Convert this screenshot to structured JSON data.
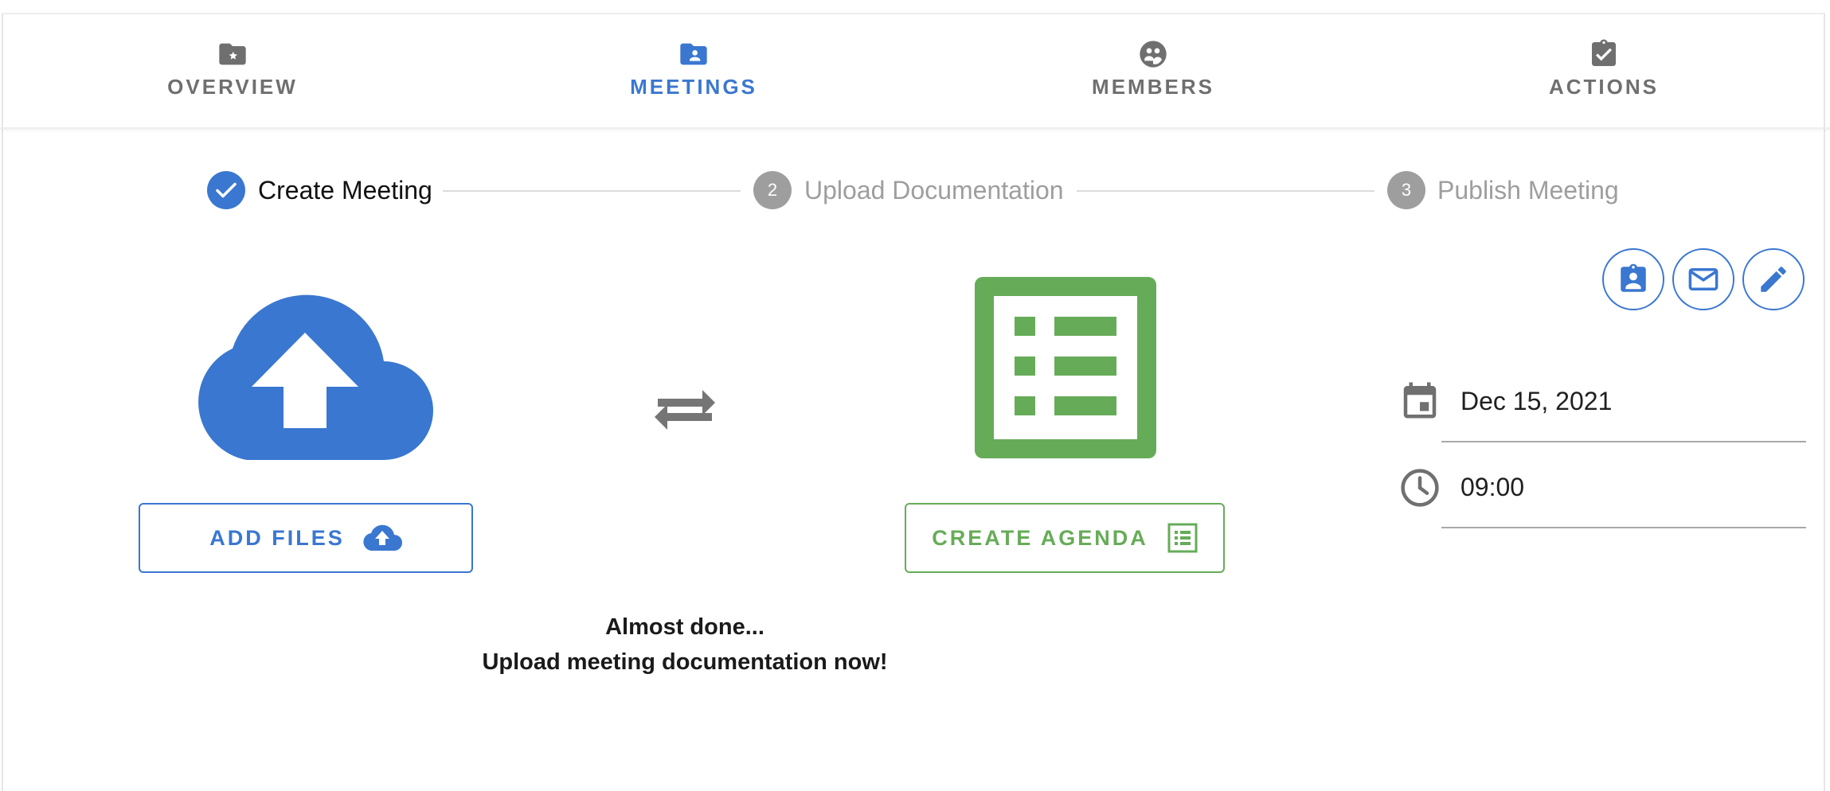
{
  "tabs": [
    {
      "label": "OVERVIEW",
      "icon": "folder-star-icon",
      "active": false
    },
    {
      "label": "MEETINGS",
      "icon": "folder-user-icon",
      "active": true
    },
    {
      "label": "MEMBERS",
      "icon": "group-icon",
      "active": false
    },
    {
      "label": "ACTIONS",
      "icon": "clipboard-check-icon",
      "active": false
    }
  ],
  "stepper": {
    "steps": [
      {
        "number": "1",
        "label": "Create Meeting",
        "status": "completed"
      },
      {
        "number": "2",
        "label": "Upload Documentation",
        "status": "inactive"
      },
      {
        "number": "3",
        "label": "Publish Meeting",
        "status": "inactive"
      }
    ]
  },
  "upload": {
    "button_label": "ADD FILES",
    "icon": "cloud-upload-icon"
  },
  "agenda": {
    "button_label": "CREATE AGENDA",
    "icon": "list-alt-icon"
  },
  "transfer_icon": "swap-horiz-icon",
  "message": {
    "line1": "Almost done...",
    "line2": "Upload meeting documentation now!"
  },
  "meeting": {
    "date": "Dec 15, 2021",
    "time": "09:00"
  },
  "actions": [
    {
      "name": "contact-card-icon"
    },
    {
      "name": "email-icon"
    },
    {
      "name": "edit-icon"
    }
  ],
  "colors": {
    "primary": "#3a77d0",
    "success": "#66ac58",
    "muted": "#9e9e9e",
    "tab_inactive": "#6f6f6f"
  }
}
